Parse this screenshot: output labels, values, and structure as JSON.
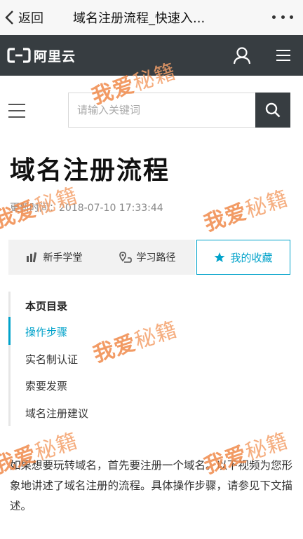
{
  "browser": {
    "back_label": "返回",
    "title": "域名注册流程_快速入..."
  },
  "header": {
    "logo_text": "阿里云"
  },
  "search": {
    "placeholder": "请输入关键词"
  },
  "doc": {
    "title": "域名注册流程",
    "updated": "更新时间：2018-07-10 17:33:44"
  },
  "tabs": [
    {
      "label": "新手学堂",
      "icon": "chart-icon"
    },
    {
      "label": "学习路径",
      "icon": "map-pin-icon"
    },
    {
      "label": "我的收藏",
      "icon": "star-icon"
    }
  ],
  "toc": {
    "heading": "本页目录",
    "items": [
      "操作步骤",
      "实名制认证",
      "索要发票",
      "域名注册建议"
    ]
  },
  "body": {
    "paragraph": "如果想要玩转域名，首先要注册一个域名。以下视频为您形象地讲述了域名注册的流程。具体操作步骤，请参见下文描述。"
  },
  "watermark": {
    "part1": "我爱",
    "part2": "秘籍"
  },
  "colors": {
    "header_bg": "#373d41",
    "accent": "#00a2ca",
    "watermark": "#f08a4b"
  }
}
